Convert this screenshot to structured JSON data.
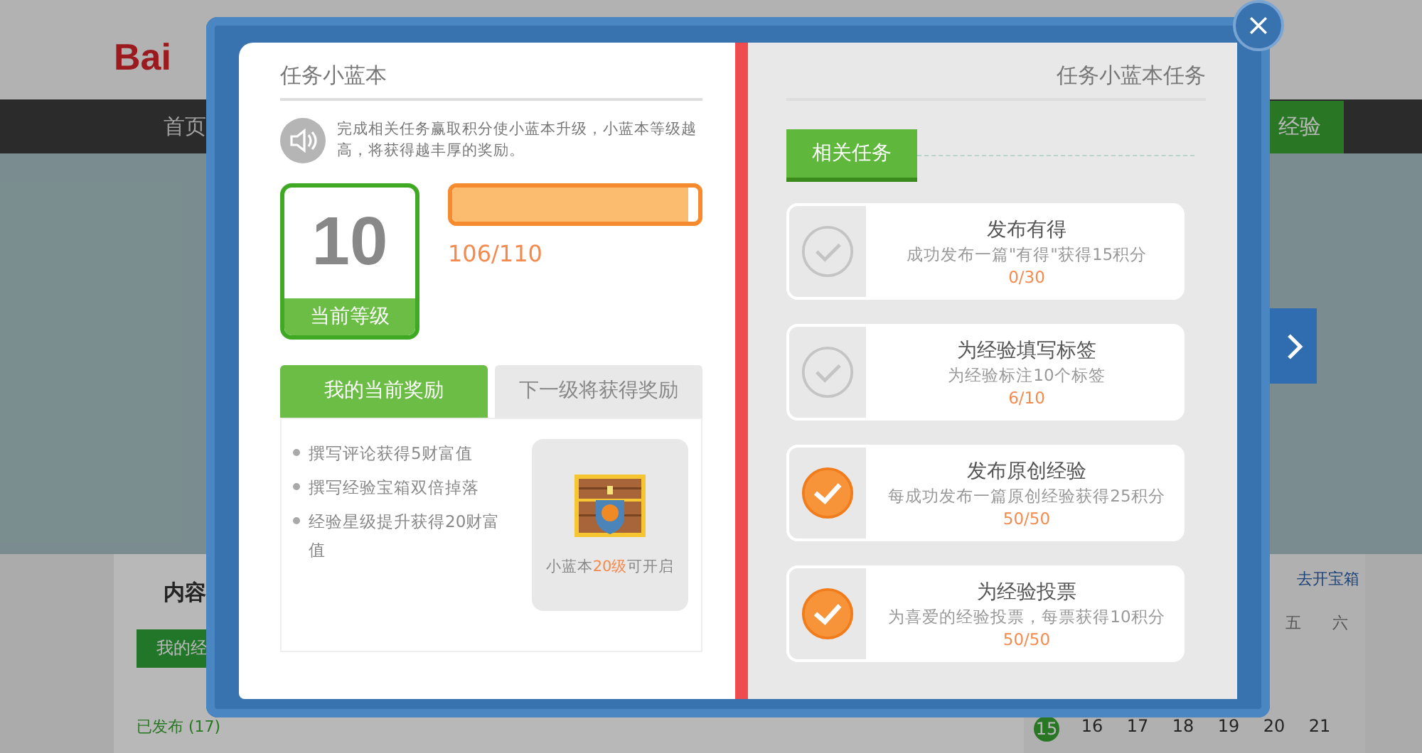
{
  "background": {
    "logo": "Bai",
    "nav": [
      {
        "label": "首页",
        "selected": false
      },
      {
        "label": "经验",
        "selected": true
      }
    ],
    "section_title": "内容",
    "side_link": "去开宝箱",
    "tab": "我的经",
    "status": "已发布 (17)",
    "weekdays": [
      "五",
      "六"
    ],
    "dates": [
      {
        "label": "15",
        "highlighted": true
      },
      {
        "label": "16",
        "highlighted": false
      },
      {
        "label": "17",
        "highlighted": false
      },
      {
        "label": "18",
        "highlighted": false
      },
      {
        "label": "19",
        "highlighted": false
      },
      {
        "label": "20",
        "highlighted": false
      },
      {
        "label": "21",
        "highlighted": false
      }
    ]
  },
  "dialog": {
    "left_title": "任务小蓝本",
    "intro": "完成相关任务赢取积分使小蓝本升级，小蓝本等级越高，将获得越丰厚的奖励。",
    "level_number": "10",
    "level_label": "当前等级",
    "progress": {
      "level": 0.96,
      "reading": "106/110"
    },
    "reward_tabs": [
      {
        "label": "我的当前奖励",
        "selected": true
      },
      {
        "label": "下一级将获得奖励",
        "selected": false
      }
    ],
    "rewards": [
      "撰写评论获得5财富值",
      "撰写经验宝箱双倍掉落",
      "经验星级提升获得20财富值"
    ],
    "chest_caption": {
      "before": "小蓝本",
      "highlight": "20级",
      "after": "可开启"
    },
    "right_title": "任务小蓝本任务",
    "section_tag": "相关任务",
    "tasks": [
      {
        "title": "发布有得",
        "description": "成功发布一篇\"有得\"获得15积分",
        "progress": "0/30",
        "done": false
      },
      {
        "title": "为经验填写标签",
        "description": "为经验标注10个标签",
        "progress": "6/10",
        "done": false
      },
      {
        "title": "发布原创经验",
        "description": "每成功发布一篇原创经验获得25积分",
        "progress": "50/50",
        "done": true
      },
      {
        "title": "为经验投票",
        "description": "为喜爱的经验投票，每票获得10积分",
        "progress": "50/50",
        "done": true
      }
    ]
  }
}
